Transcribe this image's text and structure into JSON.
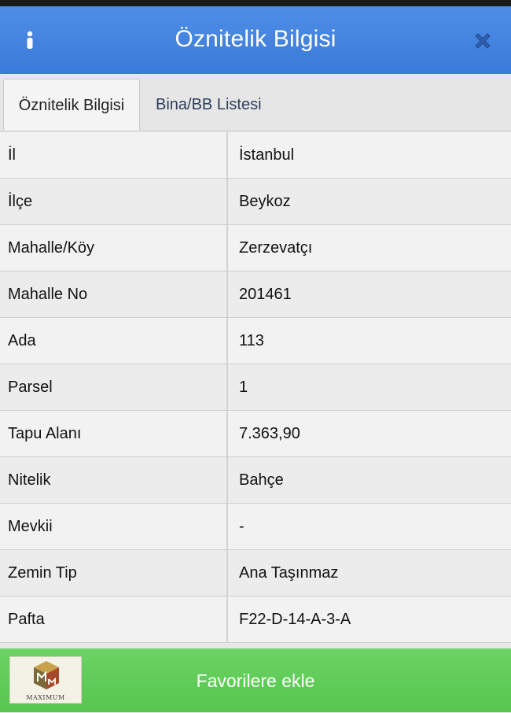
{
  "header": {
    "title": "Öznitelik Bilgisi",
    "left_icon": "info-icon",
    "right_icon": "close-icon"
  },
  "tabs": [
    {
      "label": "Öznitelik Bilgisi",
      "active": true
    },
    {
      "label": "Bina/BB Listesi",
      "active": false
    }
  ],
  "rows": [
    {
      "label": "İl",
      "value": "İstanbul"
    },
    {
      "label": "İlçe",
      "value": "Beykoz"
    },
    {
      "label": "Mahalle/Köy",
      "value": "Zerzevatçı"
    },
    {
      "label": "Mahalle No",
      "value": "201461"
    },
    {
      "label": "Ada",
      "value": "113"
    },
    {
      "label": "Parsel",
      "value": "1"
    },
    {
      "label": "Tapu Alanı",
      "value": "7.363,90"
    },
    {
      "label": "Nitelik",
      "value": "Bahçe"
    },
    {
      "label": "Mevkii",
      "value": "-"
    },
    {
      "label": "Zemin Tip",
      "value": "Ana Taşınmaz"
    },
    {
      "label": "Pafta",
      "value": "F22-D-14-A-3-A"
    }
  ],
  "footer": {
    "button_label": "Favorilere ekle",
    "logo_text": "MAXIMUM"
  },
  "colors": {
    "header": "#4286e0",
    "footer": "#5ecb56",
    "close_icon": "#2f5fb3"
  }
}
